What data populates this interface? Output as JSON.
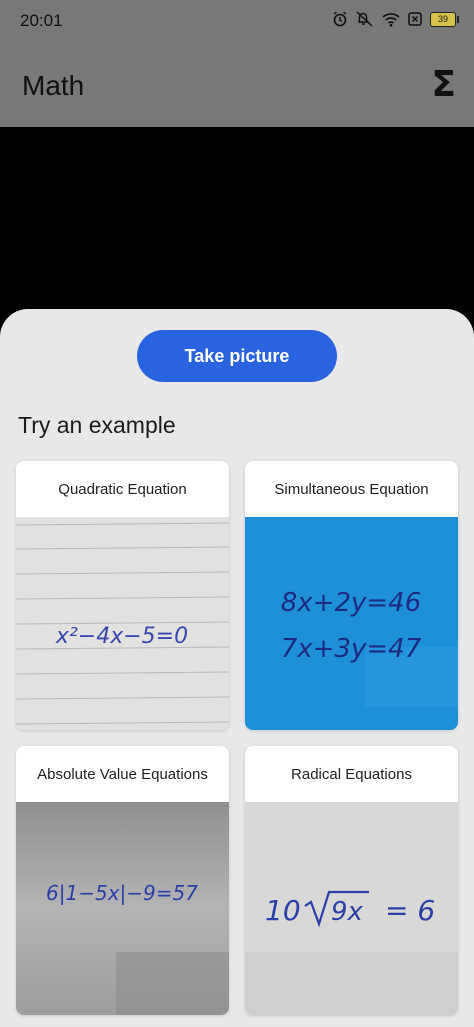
{
  "status_bar": {
    "time": "20:01",
    "battery": "39",
    "icons": [
      "alarm-icon",
      "mute-icon",
      "wifi-icon",
      "sim-x-icon",
      "battery-icon"
    ]
  },
  "app_bar": {
    "title": "Math",
    "action_icon": "sigma-icon"
  },
  "sheet": {
    "take_picture_label": "Take picture",
    "examples_title": "Try an example",
    "examples": [
      {
        "title": "Quadratic Equation",
        "image_text": "x²−4x−5=0"
      },
      {
        "title": "Simultaneous Equation",
        "image_text_line1": "8x+2y=46",
        "image_text_line2": "7x+3y=47"
      },
      {
        "title": "Absolute Value Equations",
        "image_text": "6|1−5x|−9=57"
      },
      {
        "title": "Radical Equations",
        "image_text_prefix": "10",
        "image_text_radicand": "9x",
        "image_text_suffix": "= 6"
      }
    ]
  },
  "colors": {
    "accent": "#2a63e0",
    "app_bar": "#787878",
    "sheet": "#e8e8e8",
    "ink": "#2a3fa8"
  }
}
